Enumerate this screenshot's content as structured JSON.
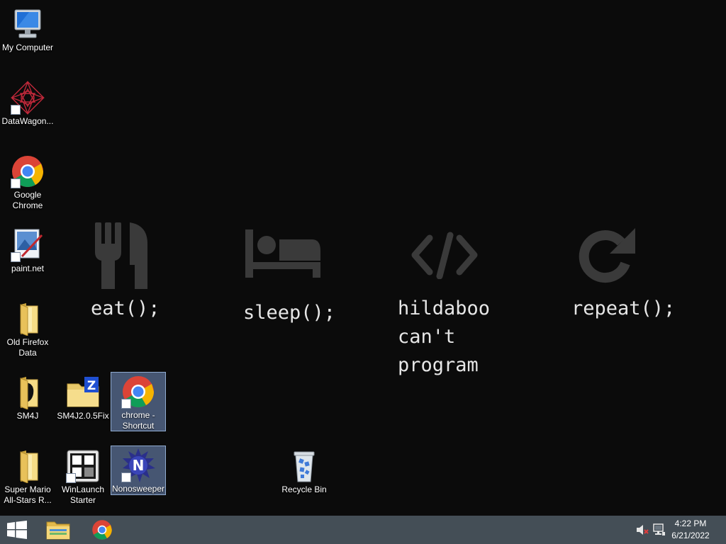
{
  "desktop": {
    "icons": [
      {
        "label": "My Computer"
      },
      {
        "label": "DataWagon..."
      },
      {
        "label": "Google\nChrome"
      },
      {
        "label": "paint.net"
      },
      {
        "label": "Old Firefox\nData"
      },
      {
        "label": "SM4J"
      },
      {
        "label": "SM4J2.0.5Fix"
      },
      {
        "label": "chrome -\nShortcut"
      },
      {
        "label": "Super Mario\nAll-Stars R..."
      },
      {
        "label": "WinLaunch\nStarter"
      },
      {
        "label": "Nonosweeper"
      },
      {
        "label": "Recycle Bin"
      }
    ]
  },
  "wallpaper": {
    "captions": [
      {
        "text": "eat();",
        "icon": "fork-knife-icon"
      },
      {
        "text": "sleep();",
        "icon": "bed-icon"
      },
      {
        "text": "hildaboo\ncan't\nprogram",
        "icon": "code-icon"
      },
      {
        "text": "repeat();",
        "icon": "refresh-icon"
      }
    ]
  },
  "taskbar": {
    "clock_time": "4:22 PM",
    "clock_date": "6/21/2022",
    "pinned": [
      "file-explorer-icon",
      "chrome-icon"
    ],
    "tray": [
      "volume-muted-icon",
      "network-icon"
    ]
  }
}
